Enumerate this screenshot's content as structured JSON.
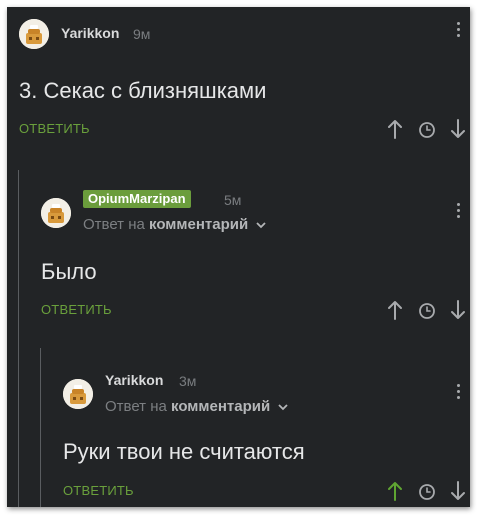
{
  "comments": [
    {
      "username": "Yarikkon",
      "time": "9м",
      "text": "3. Секас с близняшками",
      "reply_label": "ОТВЕТИТЬ",
      "highlight_username": false
    },
    {
      "username": "OpiumMarzipan",
      "time": "5м",
      "reply_prefix": "Ответ на",
      "reply_target": "комментарий",
      "text": "Было",
      "reply_label": "ОТВЕТИТЬ",
      "highlight_username": true
    },
    {
      "username": "Yarikkon",
      "time": "3м",
      "reply_prefix": "Ответ на",
      "reply_target": "комментарий",
      "text": "Руки твои не считаются",
      "reply_label": "ОТВЕТИТЬ",
      "highlight_username": false
    }
  ],
  "icons": {
    "upvote": "arrow-up-icon",
    "history": "clock-icon",
    "downvote": "arrow-down-icon",
    "menu": "more-vertical-icon",
    "expand": "chevron-down-icon"
  },
  "colors": {
    "background": "#222426",
    "accent_green": "#6aa03c",
    "upvoted_green": "#5fa532",
    "text_primary": "#e6e7e8",
    "text_muted": "#7c7f82",
    "icon_gray": "#a8aaad"
  },
  "votes": {
    "comment_3_upvoted": true
  }
}
